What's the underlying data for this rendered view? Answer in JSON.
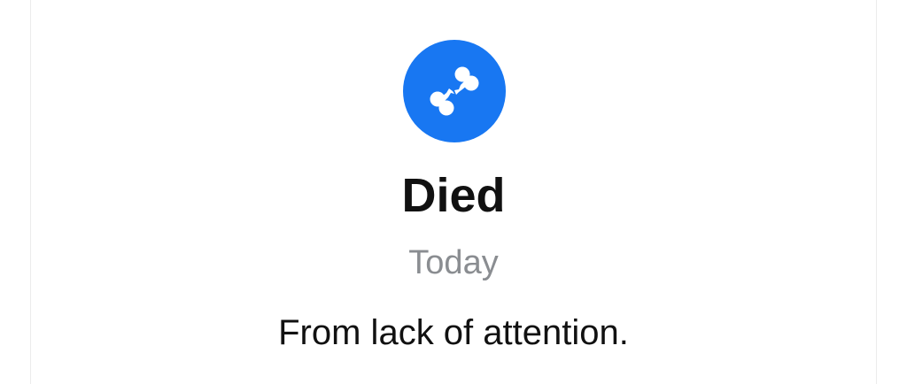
{
  "event": {
    "icon": "broken-bone-icon",
    "title": "Died",
    "date": "Today",
    "description": "From lack of attention."
  },
  "colors": {
    "icon_background": "#1877f2",
    "icon_foreground": "#ffffff",
    "title": "#111111",
    "date": "#8a8d91",
    "description": "#111111"
  }
}
